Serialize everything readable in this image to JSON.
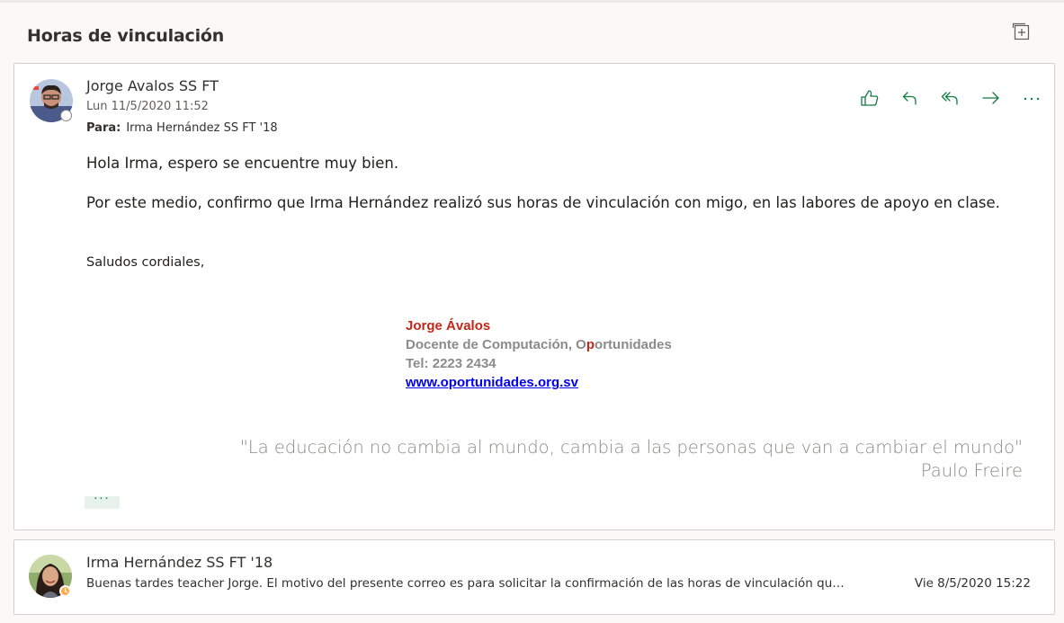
{
  "thread": {
    "subject": "Horas de vinculación",
    "popout_icon": "popout-icon"
  },
  "message": {
    "sender": "Jorge Avalos SS FT",
    "date": "Lun 11/5/2020 11:52",
    "to_label": "Para:",
    "to_value": "Irma Hernández SS FT '18",
    "actions": [
      {
        "name": "like-icon"
      },
      {
        "name": "reply-icon"
      },
      {
        "name": "reply-all-icon"
      },
      {
        "name": "forward-icon"
      },
      {
        "name": "more-actions-icon"
      }
    ],
    "body": {
      "greeting": "Hola Irma, espero se encuentre muy bien.",
      "paragraph": "Por este medio, confirmo que Irma Hernández realizó sus horas de vinculación con migo, en las labores de apoyo en clase.",
      "closing": "Saludos cordiales,"
    },
    "signature": {
      "name": "Jorge Ávalos",
      "title_prefix": "Docente de Computación, O",
      "title_red": "p",
      "title_suffix": "ortunidades",
      "phone": "Tel: 2223 2434",
      "website": "www.oportunidades.org.sv"
    },
    "quote": {
      "text": "\"La educación no cambia al mundo, cambia a las personas que van a cambiar el mundo\"",
      "author": "Paulo Freire"
    },
    "show_more_label": "···"
  },
  "previous_message": {
    "sender": "Irma Hernández SS FT '18",
    "preview": "Buenas tardes teacher Jorge. El motivo del presente correo es para solicitar la confirmación de las horas de vinculación que rea...",
    "date": "Vie 8/5/2020 15:22"
  },
  "colors": {
    "accent_green": "#107c41",
    "signature_red": "#c0281b",
    "link_blue": "#0000ee"
  }
}
